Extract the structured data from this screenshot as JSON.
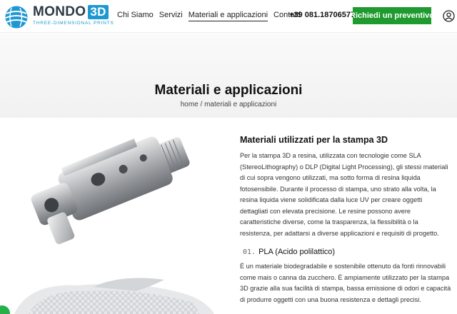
{
  "header": {
    "logo_main": "MONDO",
    "logo_3d": "3D",
    "logo_sub": "THREE-DIMENSIONAL PRINTS",
    "nav": [
      {
        "label": "Chi Siamo",
        "active": false
      },
      {
        "label": "Servizi",
        "active": false
      },
      {
        "label": "Materiali e applicazioni",
        "active": true
      },
      {
        "label": "Contatti",
        "active": false
      }
    ],
    "phone": "+39 081.18706577",
    "cta_label": "Richiedi un preventivo",
    "cta_color": "#1e9a2e",
    "brand_color": "#1f98d2",
    "user_icon": "user-circle-icon"
  },
  "hero": {
    "title": "Materiali e applicazioni",
    "breadcrumb_home": "home",
    "breadcrumb_separator": " / ",
    "breadcrumb_current": "materiali e applicazioni"
  },
  "content": {
    "section_title": "Materiali utilizzati per la stampa 3D",
    "paragraph_1": "Per la stampa 3D a resina, utilizzata con tecnologie come SLA (StereoLithography) o DLP (Digital Light Processing), gli stessi materiali di cui sopra vengono utilizzati, ma sotto forma di resina liquida fotosensibile. Durante il processo di stampa, uno strato alla volta, la resina liquida viene solidificata dalla luce UV per creare oggetti dettagliati con elevata precisione. Le resine possono avere caratteristiche diverse, come la trasparenza, la flessibilità o la resistenza, per adattarsi a diverse applicazioni e requisiti di progetto.",
    "item_number": "01.",
    "item_title": "PLA (Acido polilattico)",
    "paragraph_2": " È un materiale biodegradabile e sostenibile ottenuto da fonti rinnovabili come mais o canna da zucchero. È ampiamente utilizzato per la stampa 3D grazie alla sua facilità di stampa, bassa emissione di odori e capacità di produrre oggetti con una buona resistenza e dettagli precisi."
  }
}
